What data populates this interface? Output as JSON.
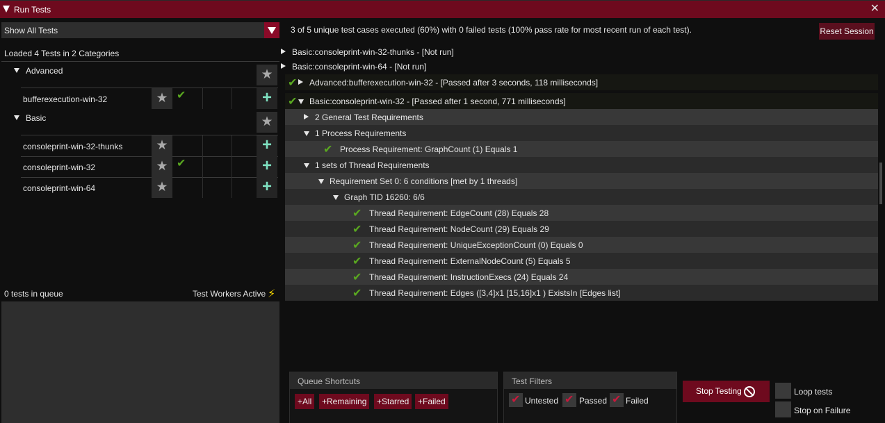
{
  "window": {
    "title": "Run Tests"
  },
  "filter": {
    "selected": "Show All Tests"
  },
  "loaded_text": "Loaded 4 Tests in 2 Categories",
  "categories": [
    {
      "name": "Advanced",
      "tests": [
        {
          "name": "bufferexecution-win-32",
          "passed": true
        }
      ]
    },
    {
      "name": "Basic",
      "tests": [
        {
          "name": "consoleprint-win-32-thunks",
          "passed": false
        },
        {
          "name": "consoleprint-win-32",
          "passed": true
        },
        {
          "name": "consoleprint-win-64",
          "passed": false
        }
      ]
    }
  ],
  "queue": {
    "count_text": "0 tests in queue",
    "workers_text": "Test Workers Active"
  },
  "summary": "3 of 5 unique test cases executed (60%) with 0 failed tests (100% pass rate for most recent run of each test).",
  "reset_label": "Reset Session",
  "results": [
    {
      "label": "Basic:consoleprint-win-32-thunks - [Not run]",
      "state": "collapsed",
      "check": false
    },
    {
      "label": "Basic:consoleprint-win-64 - [Not run]",
      "state": "collapsed",
      "check": false
    },
    {
      "label": "Advanced:bufferexecution-win-32 - [Passed after 3 seconds, 118 milliseconds]",
      "state": "collapsed",
      "check": true
    },
    {
      "label": "Basic:consoleprint-win-32 - [Passed after 1 second, 771 milliseconds]",
      "state": "expanded",
      "check": true
    },
    {
      "label": "2 General Test Requirements",
      "state": "collapsed",
      "check": false
    },
    {
      "label": "1 Process Requirements",
      "state": "expanded",
      "check": false
    },
    {
      "label": "Process Requirement: GraphCount (1) Equals 1",
      "state": "leaf",
      "check": true
    },
    {
      "label": "1 sets of Thread Requirements",
      "state": "expanded",
      "check": false
    },
    {
      "label": "Requirement Set 0: 6 conditions [met by 1 threads]",
      "state": "expanded",
      "check": false
    },
    {
      "label": "Graph TID 16260: 6/6",
      "state": "expanded",
      "check": false
    },
    {
      "label": "Thread Requirement: EdgeCount (28) Equals 28",
      "state": "leaf",
      "check": true
    },
    {
      "label": "Thread Requirement: NodeCount (29) Equals 29",
      "state": "leaf",
      "check": true
    },
    {
      "label": "Thread Requirement: UniqueExceptionCount (0) Equals 0",
      "state": "leaf",
      "check": true
    },
    {
      "label": "Thread Requirement: ExternalNodeCount (5) Equals 5",
      "state": "leaf",
      "check": true
    },
    {
      "label": "Thread Requirement: InstructionExecs (24) Equals 24",
      "state": "leaf",
      "check": true
    },
    {
      "label": "Thread Requirement: Edges ([3,4]x1 [15,16]x1 ) ExistsIn [Edges list]",
      "state": "leaf",
      "check": true
    }
  ],
  "shortcuts": {
    "title": "Queue Shortcuts",
    "buttons": [
      "+All",
      "+Remaining",
      "+Starred",
      "+Failed"
    ]
  },
  "filters": {
    "title": "Test Filters",
    "items": [
      {
        "label": "Untested",
        "checked": true
      },
      {
        "label": "Passed",
        "checked": true
      },
      {
        "label": "Failed",
        "checked": true
      }
    ]
  },
  "stop_label": "Stop Testing",
  "options": {
    "loop": "Loop tests",
    "stop_on_failure": "Stop on Failure"
  },
  "colors": {
    "title_bar": "#6e0a1e",
    "accent": "#8a0a28",
    "check": "#5aa820",
    "plus": "#7ee0c0",
    "bolt": "#f4d400"
  }
}
